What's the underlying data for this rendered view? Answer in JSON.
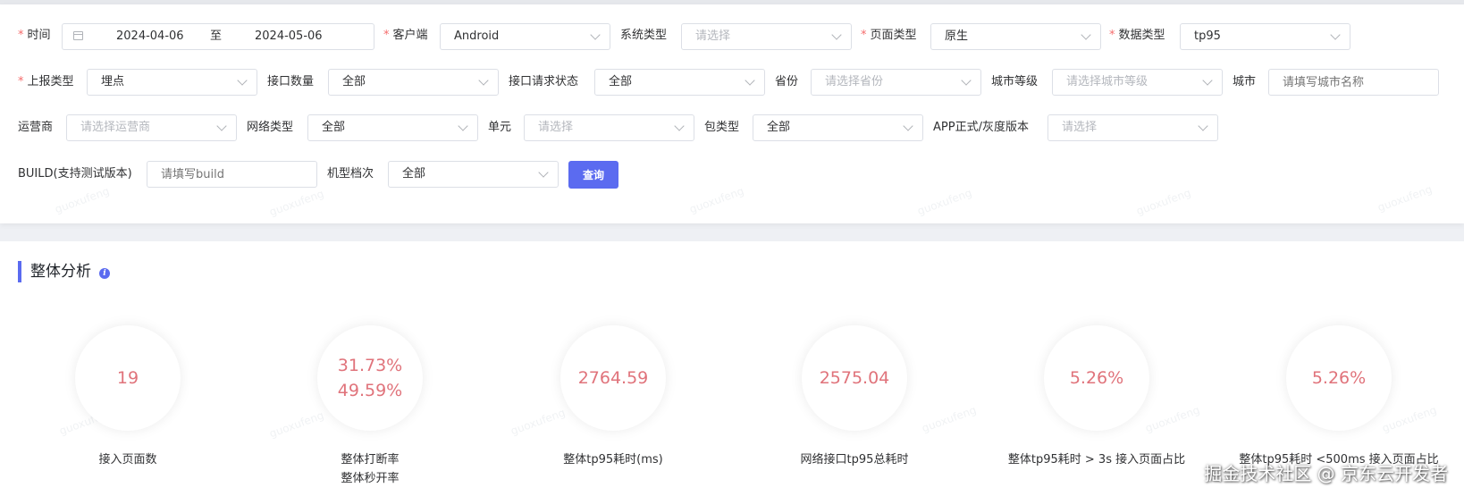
{
  "filters": {
    "time_label": "时间",
    "date_start": "2024-04-06",
    "date_sep": "至",
    "date_end": "2024-05-06",
    "client_label": "客户端",
    "client_value": "Android",
    "system_label": "系统类型",
    "system_placeholder": "请选择",
    "page_type_label": "页面类型",
    "page_type_value": "原生",
    "data_type_label": "数据类型",
    "data_type_value": "tp95",
    "report_type_label": "上报类型",
    "report_type_value": "埋点",
    "api_count_label": "接口数量",
    "api_count_value": "全部",
    "api_status_label": "接口请求状态",
    "api_status_value": "全部",
    "province_label": "省份",
    "province_placeholder": "请选择省份",
    "city_level_label": "城市等级",
    "city_level_placeholder": "请选择城市等级",
    "city_label": "城市",
    "city_placeholder": "请填写城市名称",
    "carrier_label": "运营商",
    "carrier_placeholder": "请选择运营商",
    "network_label": "网络类型",
    "network_value": "全部",
    "unit_label": "单元",
    "unit_placeholder": "请选择",
    "package_label": "包类型",
    "package_value": "全部",
    "app_version_label": "APP正式/灰度版本",
    "app_version_placeholder": "请选择",
    "build_label": "BUILD(支持测试版本)",
    "build_placeholder": "请填写build",
    "device_tier_label": "机型档次",
    "device_tier_value": "全部",
    "query_button": "查询"
  },
  "overview": {
    "title": "整体分析",
    "info_glyph": "i",
    "metrics": [
      {
        "value": "19",
        "label": "接入页面数"
      },
      {
        "value": "31.73%",
        "value2": "49.59%",
        "label": "整体打断率",
        "label2": "整体秒开率"
      },
      {
        "value": "2764.59",
        "label": "整体tp95耗时(ms)"
      },
      {
        "value": "2575.04",
        "label": "网络接口tp95总耗时"
      },
      {
        "value": "5.26%",
        "label": "整体tp95耗时 > 3s 接入页面占比"
      },
      {
        "value": "5.26%",
        "label": "整体tp95耗时 <500ms 接入页面占比"
      }
    ]
  },
  "watermark": "guoxufeng",
  "brand_watermark": "掘金技术社区 @ 京东云开发者",
  "colors": {
    "accent": "#5b6bf0",
    "metric_value": "#e0737b",
    "required": "#f56c6c"
  }
}
